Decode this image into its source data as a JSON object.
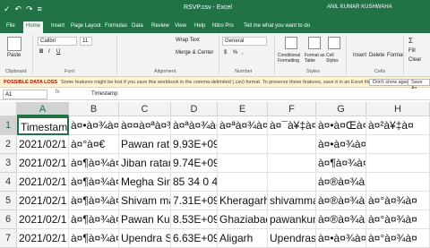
{
  "title": {
    "quick_access": [
      "✓",
      "↶",
      "↷",
      "≡"
    ],
    "window_title": "RSVP.csv - Excel",
    "user": "ANIL KUMAR KUSHWAHA"
  },
  "tabs": [
    "File",
    "Home",
    "Insert",
    "Page Layout",
    "Formulas",
    "Data",
    "Review",
    "View",
    "Help",
    "Nitro Pro"
  ],
  "tell_me": "Tell me what you want to do",
  "ribbon": {
    "clipboard": {
      "paste": "Paste",
      "label": "Clipboard"
    },
    "font": {
      "name": "Calibri",
      "size": "11",
      "bold": "B",
      "italic": "I",
      "underline": "U",
      "label": "Font"
    },
    "alignment": {
      "wrap": "Wrap Text",
      "merge": "Merge & Center",
      "label": "Alignment"
    },
    "number": {
      "format": "General",
      "currency": "$",
      "percent": "%",
      "comma": ",",
      "label": "Number"
    },
    "styles": {
      "conditional": "Conditional Formatting",
      "format_table": "Format as Table",
      "cell_styles": "Cell Styles",
      "label": "Styles"
    },
    "cells": {
      "insert": "Insert",
      "delete": "Delete",
      "format": "Format",
      "label": "Cells"
    },
    "editing": {
      "autosum": "Σ",
      "fill": "Fill",
      "clear": "Clear"
    }
  },
  "warning": {
    "label": "POSSIBLE DATA LOSS",
    "message": "Some features might be lost if you save this workbook in the comma-delimited (.csv) format. To preserve these features, save it in an Excel file format.",
    "dismiss": "Don't show again",
    "save_as": "Save As..."
  },
  "formula_bar": {
    "name_box": "A1",
    "fx": "fx",
    "value": "Timestamp"
  },
  "columns": [
    "A",
    "B",
    "C",
    "D",
    "E",
    "F",
    "G",
    "H"
  ],
  "rows": [
    "1",
    "2",
    "3",
    "4",
    "5",
    "6",
    "7"
  ],
  "cells": [
    [
      "Timestam",
      "à¤•à¤¾à¤",
      "à¤¤à¤ªà¤¾à¤",
      "à¤ªà¤¾à¤¨",
      "à¤ªà¤¾à¤¨à¤",
      "à¤¯à¥‡à¤",
      "à¤•à¤Œà¤",
      "à¤²à¥‡à¤"
    ],
    [
      "2021/02/1",
      "à¤°à¤€",
      "Pawan rat",
      "9.93E+09",
      "",
      "",
      "à¤•à¤¾à¤°",
      ""
    ],
    [
      "2021/02/1",
      "à¤¶à¤¾à¤",
      "Jiban ratar",
      "9.74E+09",
      "",
      "",
      "à¤¶à¤¾à¤°à¤•",
      ""
    ],
    [
      "2021/02/1",
      "à¤¶à¤¾à¤",
      "Megha Sin",
      "85 34 0 44 109",
      "",
      "",
      "à¤®à¤¾à¤°à¤¾",
      ""
    ],
    [
      "2021/02/1",
      "à¤¶à¤¾à¤",
      "Shivam ma",
      "7.31E+09",
      "Kheragarh",
      "shivamma",
      "à¤®à¤¾à¤°à¤",
      "à¤°à¤¾à¤"
    ],
    [
      "2021/02/1",
      "à¤¶à¤¾à¤",
      "Pawan Ku",
      "8.53E+09",
      "Ghaziabad",
      "pawankun",
      "à¤®à¤¾à¤°à¤",
      "à¤°à¤¾à¤"
    ],
    [
      "2021/02/1",
      "à¤¶à¤¾à¤",
      "Upendra S",
      "6.63E+09",
      "Aligarh",
      "Upendrasi",
      "à¤•à¤¾à¤",
      "à¤°à¤¾à¤"
    ]
  ],
  "colors": {
    "accent": "#217346",
    "warning_bg": "#fff4ce",
    "warning_label": "#c00000"
  }
}
